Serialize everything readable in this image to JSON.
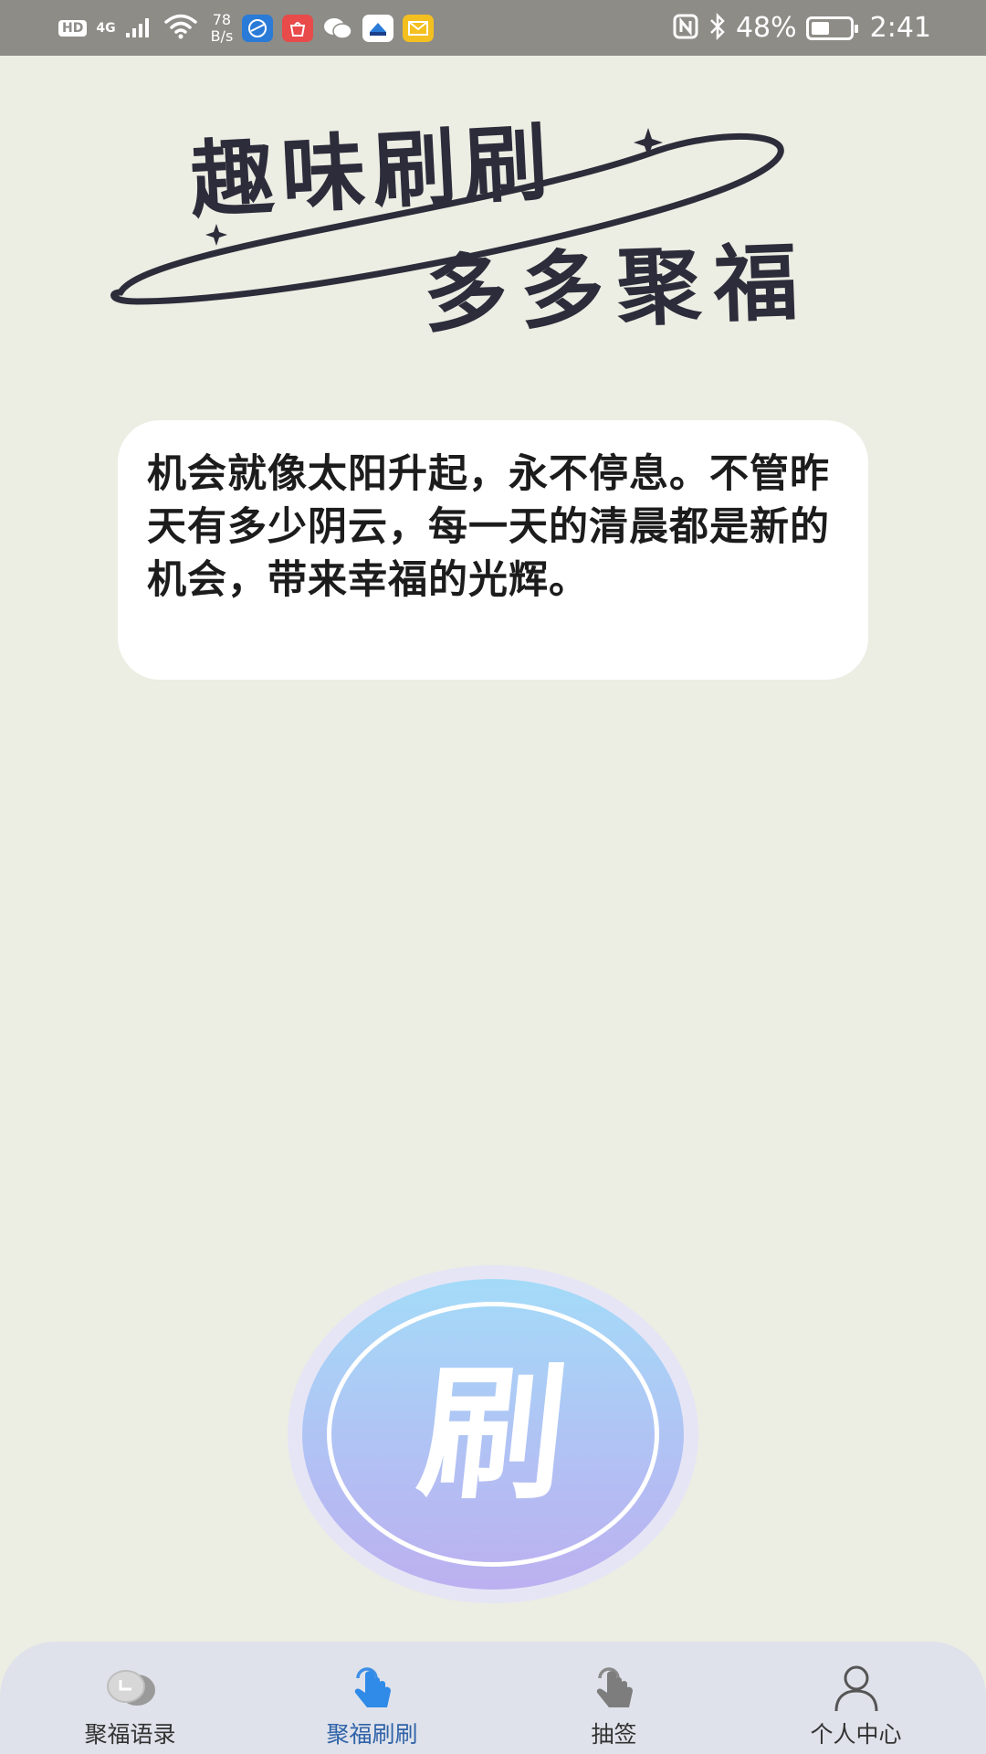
{
  "status_bar": {
    "hd": "HD",
    "network": "4G",
    "speed_value": "78",
    "speed_unit": "B/s",
    "battery": "48%",
    "battery_level": 0.48,
    "time": "2:41",
    "app_icons": [
      "browser-icon",
      "huawei-store-icon",
      "wechat-icon",
      "maps-icon",
      "mail-icon"
    ]
  },
  "logo": {
    "line1": "趣味刷刷",
    "line2": "多多聚福"
  },
  "quote": {
    "text": "机会就像太阳升起，永不停息。不管昨天有多少阴云，每一天的清晨都是新的机会，带来幸福的光辉。"
  },
  "brush_button": {
    "label": "刷"
  },
  "nav": {
    "items": [
      {
        "label": "聚福语录",
        "icon": "quote-bubble-icon",
        "active": false
      },
      {
        "label": "聚福刷刷",
        "icon": "tap-hand-icon",
        "active": true
      },
      {
        "label": "抽签",
        "icon": "draw-hand-icon",
        "active": false
      },
      {
        "label": "个人中心",
        "icon": "person-icon",
        "active": false
      }
    ]
  },
  "colors": {
    "background": "#ecede3",
    "status_bar": "#8d8c87",
    "nav_active": "#2f63a8",
    "logo_ink": "#2d2c3a"
  }
}
